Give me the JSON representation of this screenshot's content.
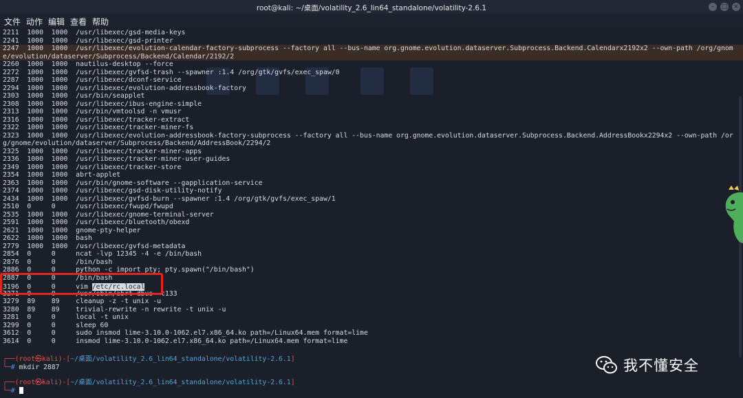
{
  "window": {
    "title": "root@kali: ~/桌面/volatility_2.6_lin64_standalone/volatility-2.6.1"
  },
  "menu": [
    "文件",
    "动作",
    "编辑",
    "查看",
    "帮助"
  ],
  "process_lines": [
    "2211  1000  1000  /usr/libexec/gsd-media-keys",
    "2241  1000  1000  /usr/libexec/gsd-printer",
    "2247  1000  1000  /usr/libexec/evolution-calendar-factory-subprocess --factory all --bus-name org.gnome.evolution.dataserver.Subprocess.Backend.Calendarx2192x2 --own-path /org/gnom",
    "e/evolution/dataserver/Subprocess/Backend/Calendar/2192/2",
    "2260  1000  1000  nautilus-desktop --force",
    "2272  1000  1000  /usr/libexec/gvfsd-trash --spawner :1.4 /org/gtk/gvfs/exec_spaw/0",
    "2287  1000  1000  /usr/libexec/dconf-service",
    "2294  1000  1000  /usr/libexec/evolution-addressbook-factory",
    "2303  1000  1000  /usr/bin/seapplet",
    "2308  1000  1000  /usr/libexec/ibus-engine-simple",
    "2313  1000  1000  /usr/bin/vmtoolsd -n vmusr",
    "2316  1000  1000  /usr/libexec/tracker-extract",
    "2322  1000  1000  /usr/libexec/tracker-miner-fs",
    "2323  1000  1000  /usr/libexec/evolution-addressbook-factory-subprocess --factory all --bus-name org.gnome.evolution.dataserver.Subprocess.Backend.AddressBookx2294x2 --own-path /or",
    "g/gnome/evolution/dataserver/Subprocess/Backend/AddressBook/2294/2",
    "2325  1000  1000  /usr/libexec/tracker-miner-apps",
    "2336  1000  1000  /usr/libexec/tracker-miner-user-guides",
    "2349  1000  1000  /usr/libexec/tracker-store",
    "2354  1000  1000  abrt-applet",
    "2363  1000  1000  /usr/bin/gnome-software --gapplication-service",
    "2374  1000  1000  /usr/libexec/gsd-disk-utility-notify",
    "2434  1000  1000  /usr/libexec/gvfsd-burn --spawner :1.4 /org/gtk/gvfs/exec_spaw/1",
    "2510  0     0     /usr/libexec/fwupd/fwupd",
    "2535  1000  1000  /usr/libexec/gnome-terminal-server",
    "2591  1000  1000  /usr/libexec/bluetooth/obexd",
    "2621  1000  1000  gnome-pty-helper",
    "2622  1000  1000  bash",
    "2779  1000  1000  /usr/libexec/gvfsd-metadata",
    "2854  0     0     ncat -lvp 12345 -4 -e /bin/bash",
    "2876  0     0     /bin/bash",
    "2886  0     0     python -c import pty; pty.spawn(\"/bin/bash\")",
    "2887  0     0     /bin/bash",
    "3196  0     0     vim /etc/rc.local",
    "3271  0     0     /usr/sbin/abrt-dbus -t133",
    "3279  89    89    cleanup -z -t unix -u",
    "3280  89    89    trivial-rewrite -n rewrite -t unix -u",
    "3281  0     0     local -t unix",
    "3299  0     0     sleep 60",
    "3612  0     0     sudo insmod lime-3.10.0-1062.el7.x86_64.ko path=/Linux64.mem format=lime",
    "3614  0     0     insmod lime-3.10.0-1062.el7.x86_64.ko path=/Linux64.mem format=lime"
  ],
  "vim_line": {
    "prefix": "3196  0     0     vim ",
    "selected": "/etc/rc.local"
  },
  "prompt1": {
    "open": "┌──(",
    "user": "root㉿kali",
    "mid": ")-[",
    "path": "~/桌面/volatility_2.6_lin64_standalone/volatility-2.6.1",
    "close": "]",
    "hash_prefix": "└─",
    "hash": "#",
    "command": " mkdir 2887"
  },
  "prompt2": {
    "open": "┌──(",
    "user": "root㉿kali",
    "mid": ")-[",
    "path": "~/桌面/volatility_2.6_lin64_standalone/volatility-2.6.1",
    "close": "]",
    "hash_prefix": "└─",
    "hash": "#"
  },
  "watermark": {
    "text": "我不懂安全",
    "icon": "wechat-icon"
  },
  "colors": {
    "annotation": "#e3251f",
    "highlight_row": "#3a2d25",
    "prompt_user": "#e0524a",
    "prompt_path": "#4d8ff0"
  }
}
